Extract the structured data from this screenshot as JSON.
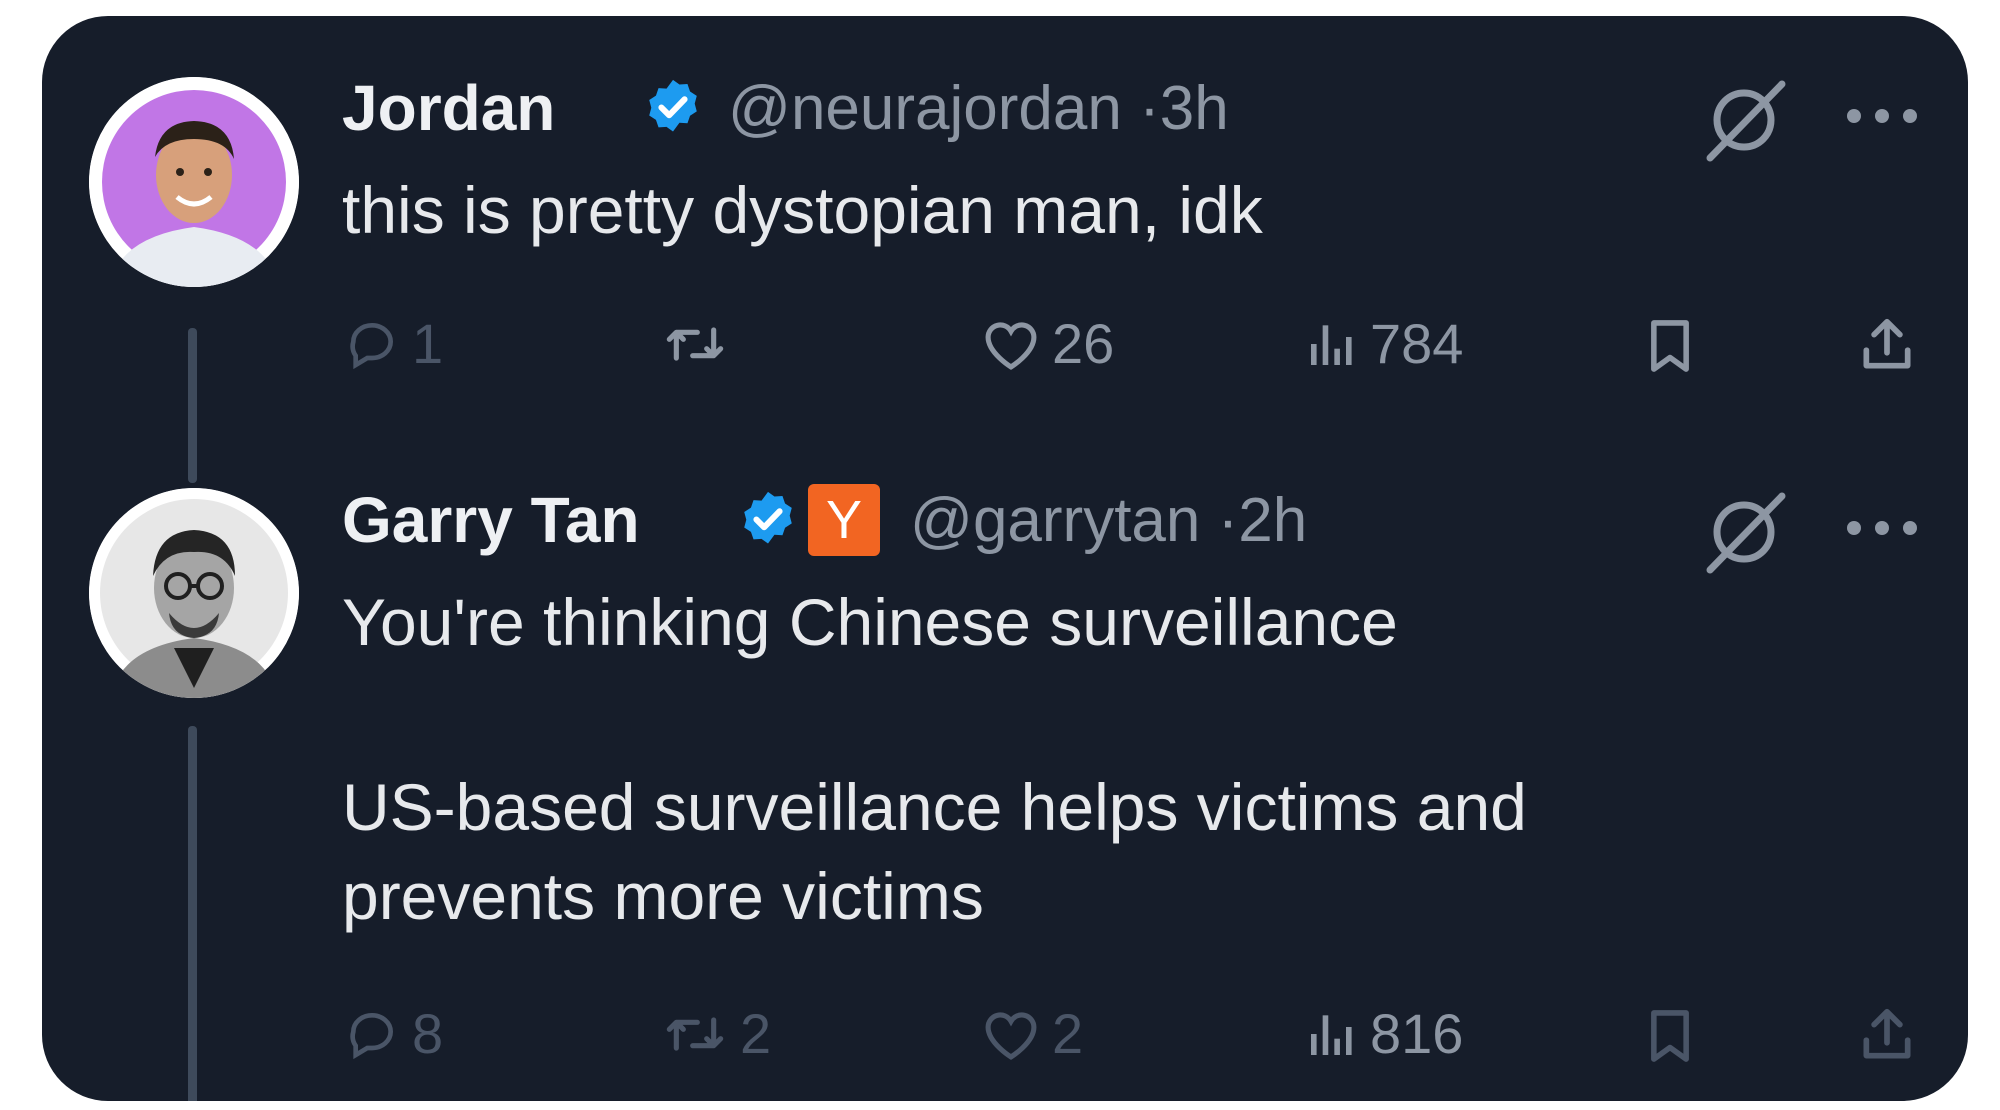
{
  "tweets": [
    {
      "name": "Jordan",
      "handle": "@neurajordan",
      "time": "3h",
      "verified": true,
      "badge": null,
      "text_lines": [
        "this is pretty dystopian man, idk"
      ],
      "actions": {
        "replies": "1",
        "retweets": "",
        "likes": "26",
        "views": "784"
      },
      "icons": [
        "grok-icon",
        "more-icon"
      ]
    },
    {
      "name": "Garry Tan",
      "handle": "@garrytan",
      "time": "2h",
      "verified": true,
      "badge": "Y",
      "text_lines": [
        "You're thinking Chinese surveillance",
        "US-based surveillance helps victims and",
        "prevents more victims"
      ],
      "actions": {
        "replies": "8",
        "retweets": "2",
        "likes": "2",
        "views": "816"
      },
      "icons": [
        "grok-icon",
        "more-icon"
      ]
    }
  ],
  "separator": "·",
  "colors": {
    "background": "#161d2a",
    "verified": "#1d9bf0",
    "yc_badge": "#f26522",
    "muted": "#8d96a3",
    "dim": "#4a5567"
  }
}
